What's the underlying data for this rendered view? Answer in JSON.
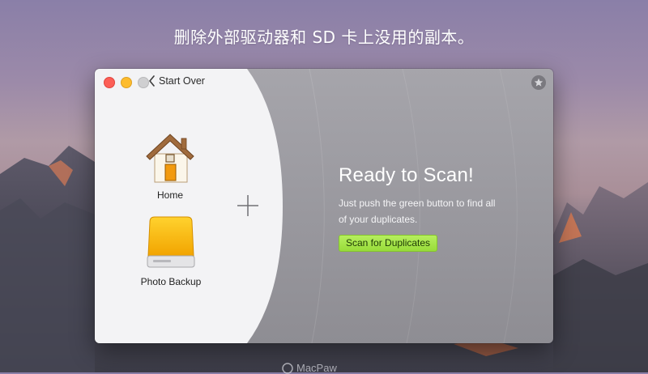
{
  "caption": "删除外部驱动器和 SD 卡上没用的副本。",
  "window": {
    "back_label": "Start Over",
    "folders": [
      {
        "label": "Home",
        "icon": "home-folder-icon"
      },
      {
        "label": "Photo Backup",
        "icon": "external-drive-icon"
      }
    ],
    "add_icon": "plus-icon",
    "favorite_icon": "star-icon",
    "ready": {
      "title": "Ready to Scan!",
      "subtitle": "Just push the green button to find all of your duplicates."
    },
    "scan_button_label": "Scan for Duplicates"
  },
  "watermark": "MacPaw",
  "colors": {
    "scan_button": "#a8e64a",
    "close": "#fc5f57",
    "minimize": "#fdbc2e",
    "zoom": "#cfcfd1"
  }
}
